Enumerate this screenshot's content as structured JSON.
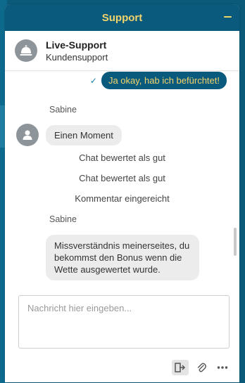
{
  "header": {
    "title": "Support"
  },
  "agent": {
    "name": "Live-Support",
    "subtitle": "Kundensupport"
  },
  "messages": {
    "own_message": "Ja okay, hab ich befürchtet!",
    "sender1": "Sabine",
    "msg1": "Einen Moment",
    "system1": "Chat bewertet als gut",
    "system2": "Chat bewertet als gut",
    "system3": "Kommentar eingereicht",
    "sender2": "Sabine",
    "msg2": "Missverständnis meinerseites, du bekommst den Bonus wenn die Wette ausgewertet wurde."
  },
  "composer": {
    "placeholder": "Nachricht hier eingeben..."
  },
  "colors": {
    "header_bg": "#0a5a7d",
    "accent": "#f2d46b",
    "bubble_gray": "#ececec"
  },
  "icons": {
    "minimize": "minus-icon",
    "agent": "service-bell-icon",
    "user": "user-icon",
    "exit": "exit-icon",
    "attach": "paperclip-icon",
    "more": "more-dots-icon"
  }
}
